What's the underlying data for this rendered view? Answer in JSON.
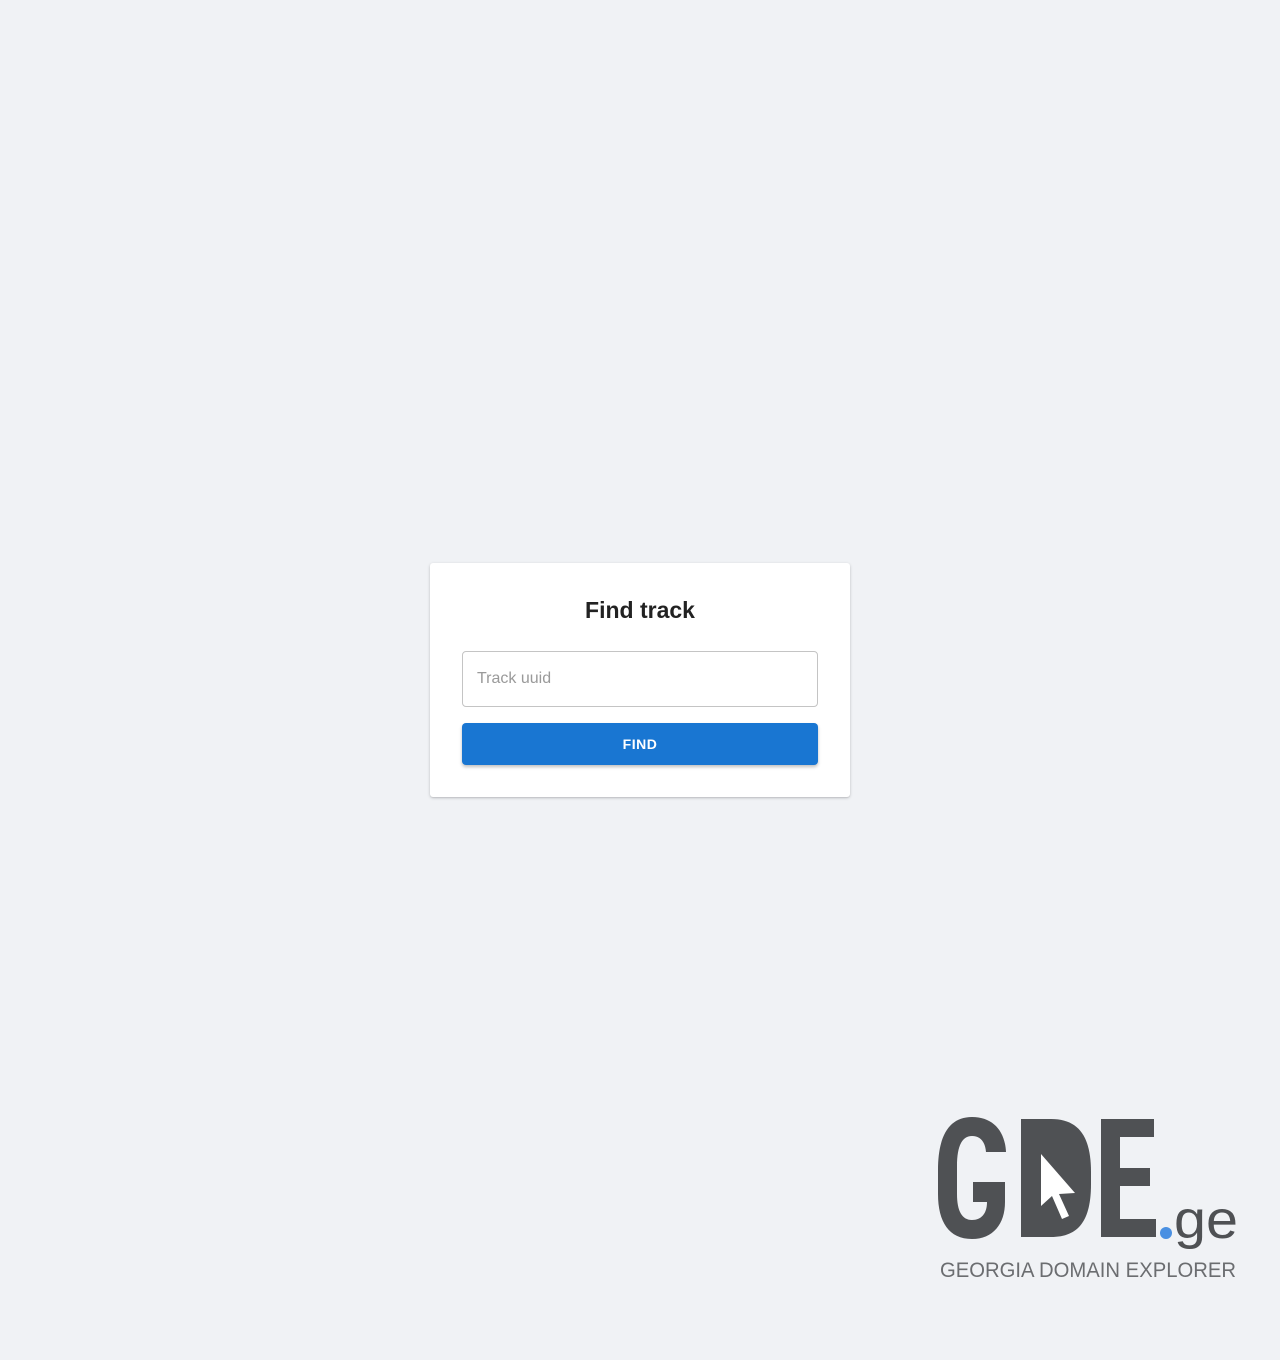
{
  "card": {
    "title": "Find track",
    "input_placeholder": "Track uuid",
    "input_value": "",
    "button_label": "FIND"
  },
  "logo": {
    "wordmark": "GDE",
    "tld": ".ge",
    "tagline": "GEORGIA DOMAIN EXPLORER"
  },
  "colors": {
    "background": "#f0f2f5",
    "card": "#ffffff",
    "primary": "#1976d2",
    "logo_gray": "#4f5154",
    "logo_dot": "#4a90e2"
  },
  "icons": {
    "logo_cursor": "cursor-arrow-icon"
  }
}
